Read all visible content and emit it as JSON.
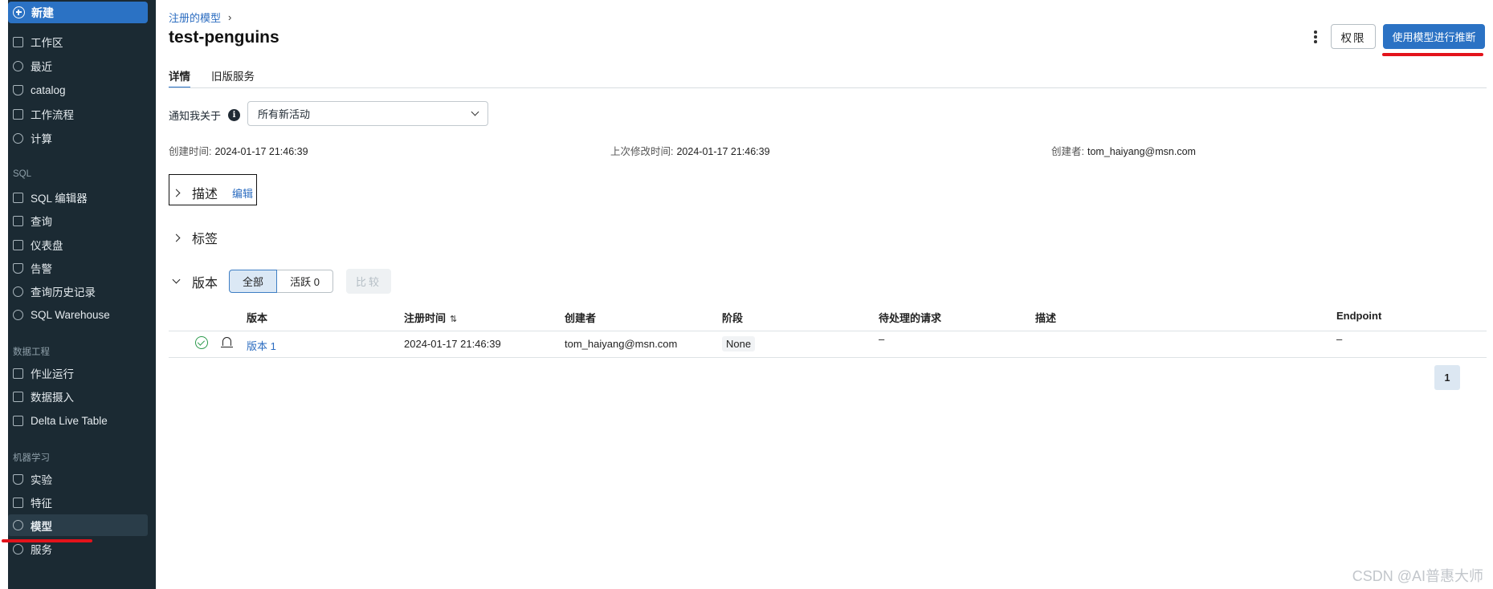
{
  "sidebar": {
    "new_label": "新建",
    "items_top": [
      {
        "label": "工作区",
        "icon": "workspace-icon"
      },
      {
        "label": "最近",
        "icon": "clock-icon"
      },
      {
        "label": "catalog",
        "icon": "catalog-icon"
      },
      {
        "label": "工作流程",
        "icon": "workflow-icon"
      },
      {
        "label": "计算",
        "icon": "cloud-icon"
      }
    ],
    "section_sql": "SQL",
    "items_sql": [
      {
        "label": "SQL 编辑器",
        "icon": "sql-editor-icon"
      },
      {
        "label": "查询",
        "icon": "query-icon"
      },
      {
        "label": "仪表盘",
        "icon": "dashboard-icon"
      },
      {
        "label": "告警",
        "icon": "bell-icon"
      },
      {
        "label": "查询历史记录",
        "icon": "history-icon"
      },
      {
        "label": "SQL Warehouse",
        "icon": "warehouse-icon"
      }
    ],
    "section_data_eng": "数据工程",
    "items_data_eng": [
      {
        "label": "作业运行",
        "icon": "job-runs-icon"
      },
      {
        "label": "数据摄入",
        "icon": "ingest-icon"
      },
      {
        "label": "Delta Live Table",
        "icon": "delta-icon"
      }
    ],
    "section_ml": "机器学习",
    "items_ml": [
      {
        "label": "实验",
        "icon": "flask-icon"
      },
      {
        "label": "特征",
        "icon": "feature-icon"
      },
      {
        "label": "模型",
        "icon": "model-icon",
        "active": true
      },
      {
        "label": "服务",
        "icon": "serving-icon"
      }
    ]
  },
  "header": {
    "breadcrumb": "注册的模型",
    "title": "test-penguins",
    "permissions_label": "权限",
    "primary_label": "使用模型进行推断"
  },
  "tabs": [
    "详情",
    "旧版服务"
  ],
  "notify": {
    "label": "通知我关于",
    "value": "所有新活动"
  },
  "meta": {
    "created_label": "创建时间:",
    "created_value": "2024-01-17 21:46:39",
    "modified_label": "上次修改时间:",
    "modified_value": "2024-01-17 21:46:39",
    "creator_label": "创建者:",
    "creator_value": "tom_haiyang@msn.com"
  },
  "sections": {
    "description": "描述",
    "edit": "编辑",
    "tags": "标签",
    "versions": "版本",
    "filter_all": "全部",
    "filter_active": "活跃 0",
    "compare": "比较"
  },
  "table": {
    "headers": [
      "版本",
      "注册时间",
      "创建者",
      "阶段",
      "待处理的请求",
      "描述",
      "Endpoint"
    ],
    "rows": [
      {
        "version": "版本 1",
        "registered": "2024-01-17 21:46:39",
        "creator": "tom_haiyang@msn.com",
        "stage": "None",
        "pending": "–",
        "description": "",
        "endpoint": "–"
      }
    ]
  },
  "pagination": {
    "current": "1"
  },
  "watermark": "CSDN @AI普惠大师",
  "colors": {
    "accent": "#2b72c4",
    "sidebar_bg": "#1b2a33",
    "highlight_red": "#e3131b"
  }
}
